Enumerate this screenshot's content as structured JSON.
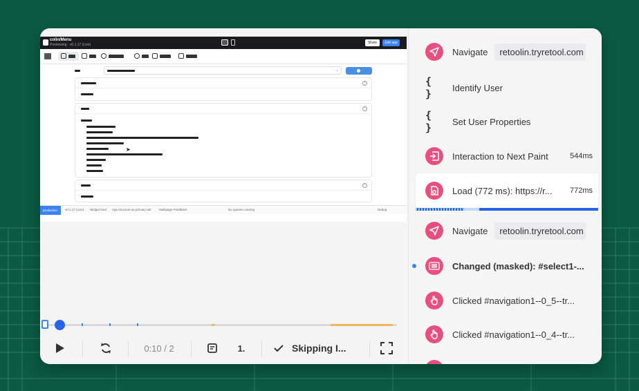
{
  "colors": {
    "background": "#0b5a42",
    "accent": "#2563eb",
    "event_icon": "#e64f7e",
    "timeline_orange": "#f5b35d"
  },
  "player": {
    "app_preview": {
      "app_name": "colin/Menu",
      "app_subtitle": "Previewing · v0.1.17 (Live)",
      "share_label": "Share",
      "edit_label": "Edit app",
      "status_env": "production",
      "status_items": [
        "v0.1.17 (Live)",
        "Widget bind",
        "App structure as primary tab",
        "Multipage Feedback"
      ],
      "status_center": "No queries running",
      "status_right": "Debug"
    },
    "timeline": {
      "progress": 0.05
    },
    "controls": {
      "play_icon": "play-icon",
      "replay_icon": "rotate-icon",
      "time": "0:10 / 2",
      "notes_icon": "note-icon",
      "speed": "1.",
      "skip_icon": "check-icon",
      "skip_label": "Skipping I...",
      "fullscreen_icon": "fullscreen-icon"
    }
  },
  "events": [
    {
      "type": "navigate",
      "icon": "navigate-icon",
      "label": "Navigate",
      "tag": "retoolin.tryretool.com",
      "duration": "",
      "selected": false,
      "bold": false,
      "dot": false
    },
    {
      "type": "identify",
      "icon": "braces-icon",
      "label": "Identify User",
      "tag": "",
      "duration": "",
      "selected": false,
      "bold": false,
      "dot": false
    },
    {
      "type": "props",
      "icon": "braces-icon",
      "label": "Set User Properties",
      "tag": "",
      "duration": "",
      "selected": false,
      "bold": false,
      "dot": false
    },
    {
      "type": "interaction",
      "icon": "interaction-icon",
      "label": "Interaction to Next Paint",
      "tag": "",
      "duration": "544ms",
      "selected": false,
      "bold": false,
      "dot": false
    },
    {
      "type": "load",
      "icon": "load-icon",
      "label": "Load (772 ms): https://r...",
      "tag": "",
      "duration": "772ms",
      "selected": true,
      "bold": false,
      "dot": false
    },
    {
      "type": "navigate",
      "icon": "navigate-icon",
      "label": "Navigate",
      "tag": "retoolin.tryretool.com",
      "duration": "",
      "selected": false,
      "bold": false,
      "dot": false
    },
    {
      "type": "changed",
      "icon": "keyboard-icon",
      "label": "Changed (masked): #select1-...",
      "tag": "",
      "duration": "",
      "selected": false,
      "bold": true,
      "dot": true
    },
    {
      "type": "click",
      "icon": "pointer-icon",
      "label": "Clicked #navigation1--0_5--tr...",
      "tag": "",
      "duration": "",
      "selected": false,
      "bold": false,
      "dot": false
    },
    {
      "type": "click",
      "icon": "pointer-icon",
      "label": "Clicked #navigation1--0_4--tr...",
      "tag": "",
      "duration": "",
      "selected": false,
      "bold": false,
      "dot": false
    }
  ]
}
